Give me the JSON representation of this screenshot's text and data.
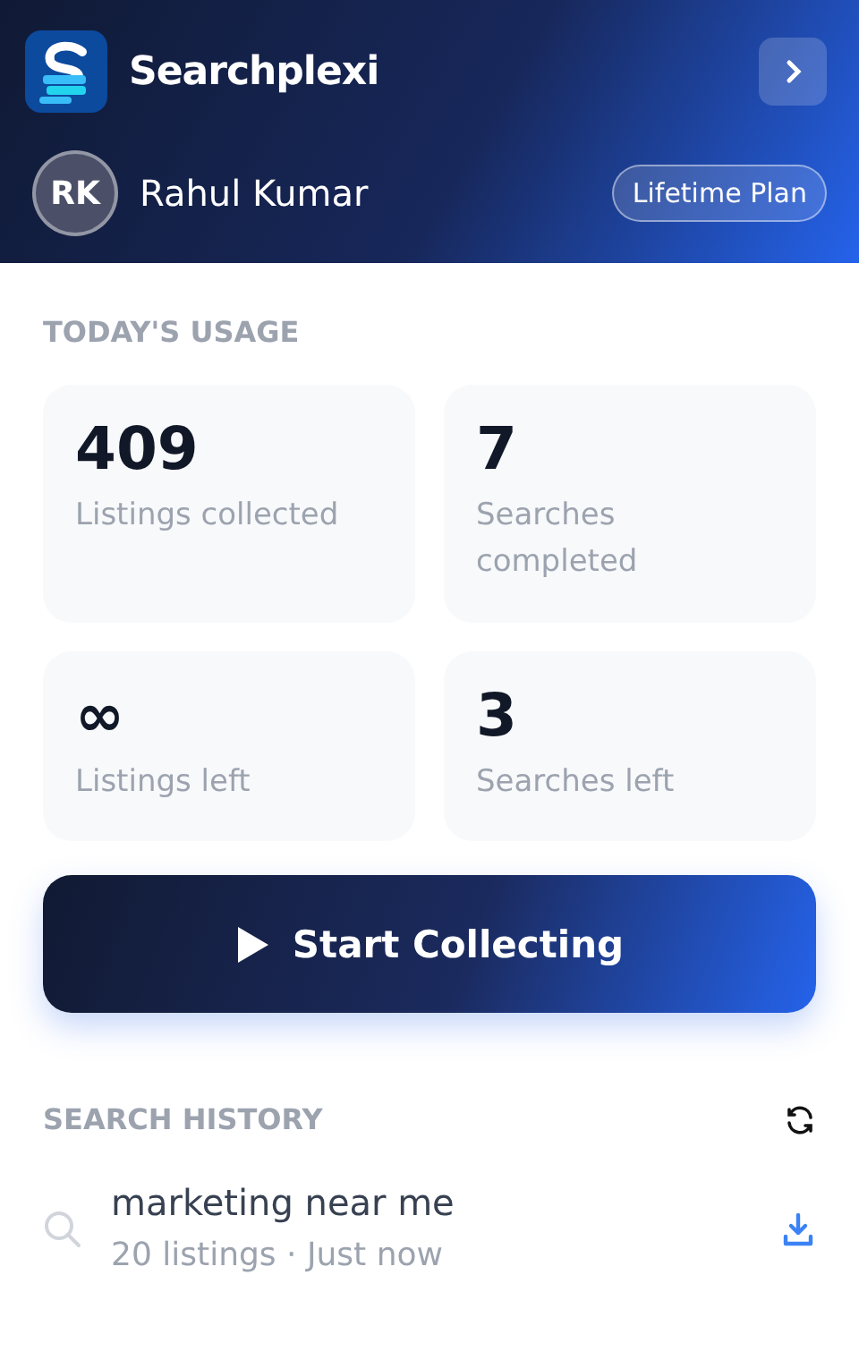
{
  "header": {
    "app_name": "Searchplexi",
    "user": {
      "initials": "RK",
      "name": "Rahul Kumar"
    },
    "plan": "Lifetime Plan"
  },
  "usage": {
    "title": "TODAY'S USAGE",
    "stats": [
      {
        "value": "409",
        "label": "Listings collected"
      },
      {
        "value": "7",
        "label": "Searches completed"
      },
      {
        "value": "∞",
        "label": "Listings left"
      },
      {
        "value": "3",
        "label": "Searches left"
      }
    ]
  },
  "start_button": "Start Collecting",
  "history": {
    "title": "SEARCH HISTORY",
    "items": [
      {
        "query": "marketing near me",
        "meta": "20 listings · Just now"
      }
    ]
  }
}
